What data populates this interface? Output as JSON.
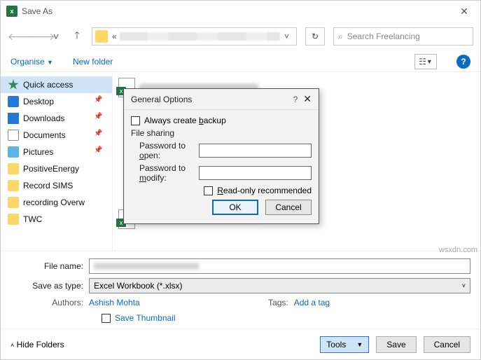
{
  "titlebar": {
    "title": "Save As"
  },
  "nav": {
    "search_placeholder": "Search Freelancing"
  },
  "toolbar": {
    "organise": "Organise",
    "new_folder": "New folder"
  },
  "sidebar": {
    "items": [
      {
        "label": "Quick access",
        "icon": "star",
        "pinned": false,
        "selected": true
      },
      {
        "label": "Desktop",
        "icon": "desk",
        "pinned": true
      },
      {
        "label": "Downloads",
        "icon": "dl",
        "pinned": true
      },
      {
        "label": "Documents",
        "icon": "doc",
        "pinned": true
      },
      {
        "label": "Pictures",
        "icon": "pic",
        "pinned": true
      },
      {
        "label": "PositiveEnergy",
        "icon": "fol",
        "pinned": false
      },
      {
        "label": "Record SIMS",
        "icon": "fol",
        "pinned": false
      },
      {
        "label": "recording Overw",
        "icon": "fol",
        "pinned": false
      },
      {
        "label": "TWC",
        "icon": "fol",
        "pinned": false
      }
    ]
  },
  "bottom": {
    "file_name_label": "File name:",
    "save_type_label": "Save as type:",
    "save_type_value": "Excel Workbook (*.xlsx)",
    "authors_label": "Authors:",
    "authors_value": "Ashish Mohta",
    "tags_label": "Tags:",
    "tags_value": "Add a tag",
    "save_thumbnail": "Save Thumbnail"
  },
  "footer": {
    "hide_folders": "Hide Folders",
    "tools": "Tools",
    "save": "Save",
    "cancel": "Cancel"
  },
  "modal": {
    "title": "General Options",
    "always_backup": "Always create backup",
    "file_sharing": "File sharing",
    "pwd_open": "Password to open:",
    "pwd_modify": "Password to modify:",
    "read_only": "Read-only recommended",
    "ok": "OK",
    "cancel": "Cancel"
  },
  "watermark": "wsxdn.com"
}
